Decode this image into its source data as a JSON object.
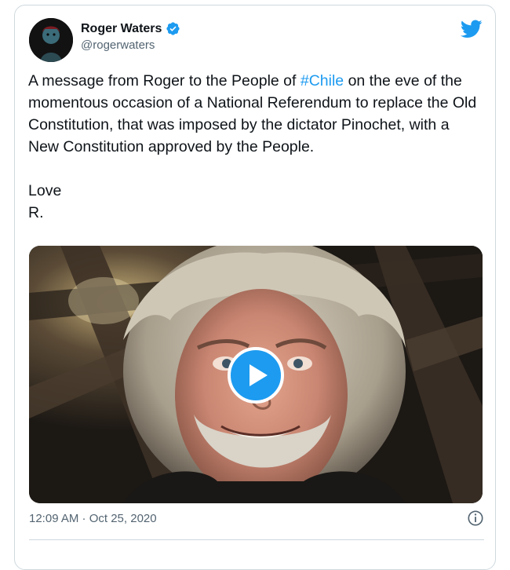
{
  "tweet": {
    "author_name": "Roger Waters",
    "author_handle": "@rogerwaters",
    "verified": true,
    "text_before_hashtag": "A message from Roger to the People of ",
    "hashtag": "#Chile",
    "text_after_hashtag": " on the eve of the momentous occasion of a National Referendum to replace the Old Constitution, that was imposed by the dictator Pinochet, with a New Constitution approved by the People.",
    "sign_off_line1": "Love",
    "sign_off_line2": "R.",
    "timestamp": "12:09 AM · Oct 25, 2020"
  },
  "icons": {
    "brand": "twitter-bird-icon",
    "verified": "verified-badge-icon",
    "play": "play-icon",
    "info": "info-icon"
  },
  "colors": {
    "accent": "#1d9bf0",
    "text_primary": "#0f1419",
    "text_secondary": "#536471",
    "border": "#cfd9de"
  }
}
